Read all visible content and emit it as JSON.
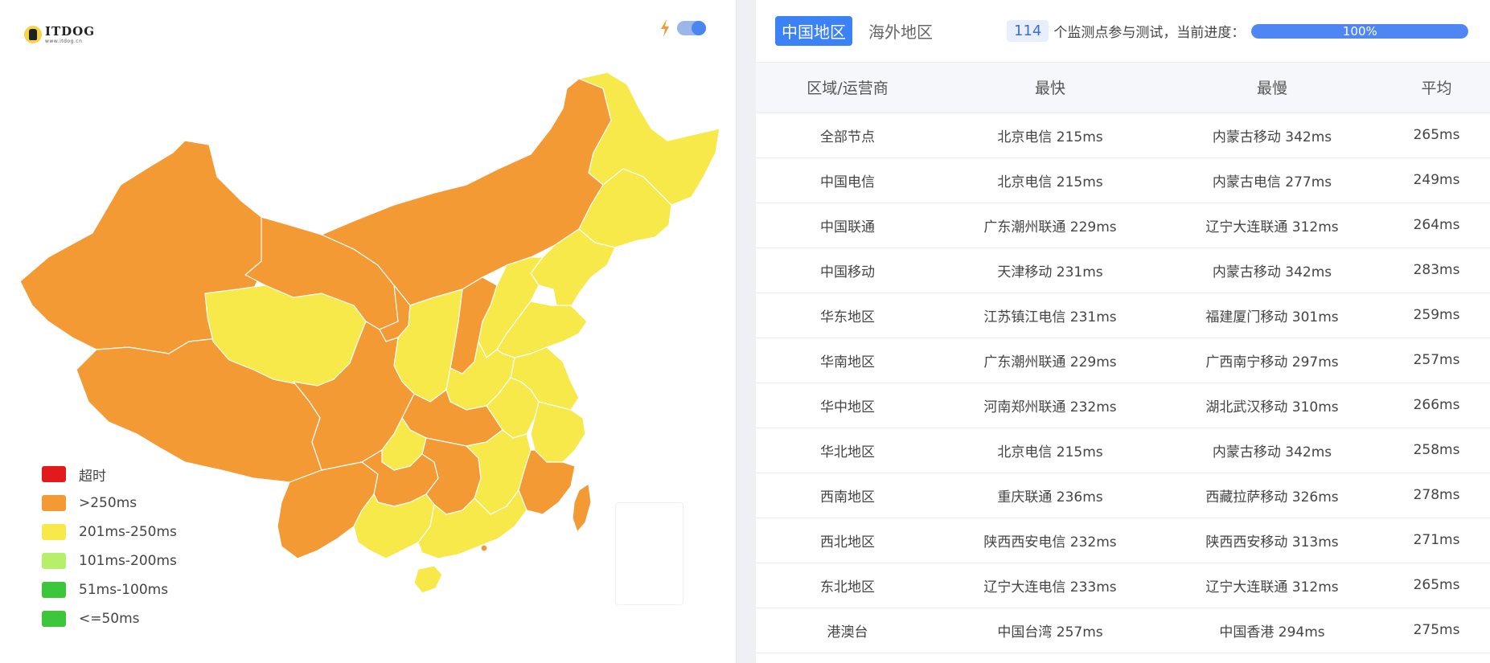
{
  "logo": {
    "title": "ITDOG",
    "subtitle": "www.itdog.cn"
  },
  "colors": {
    "timeout": "#e3191c",
    "over250": "#f49a35",
    "201_250": "#f7e94a",
    "101_200": "#b8ef6a",
    "51_100": "#3cc63c",
    "under50": "#3cc63c",
    "accent": "#3b82f6"
  },
  "legend": [
    {
      "label": "超时",
      "color": "#e3191c"
    },
    {
      "label": ">250ms",
      "color": "#f49a35"
    },
    {
      "label": "201ms-250ms",
      "color": "#f7e94a"
    },
    {
      "label": "101ms-200ms",
      "color": "#b8ef6a"
    },
    {
      "label": "51ms-100ms",
      "color": "#3cc63c"
    },
    {
      "label": "<=50ms",
      "color": "#3cc63c"
    }
  ],
  "tabs": {
    "active": "中国地区",
    "inactive": "海外地区"
  },
  "progress": {
    "count": "114",
    "text": "个监测点参与测试，当前进度：",
    "percent": 100,
    "label": "100%"
  },
  "table": {
    "headers": [
      "区域/运营商",
      "最快",
      "最慢",
      "平均"
    ],
    "rows": [
      [
        "全部节点",
        "北京电信 215ms",
        "内蒙古移动 342ms",
        "265ms"
      ],
      [
        "中国电信",
        "北京电信 215ms",
        "内蒙古电信 277ms",
        "249ms"
      ],
      [
        "中国联通",
        "广东潮州联通 229ms",
        "辽宁大连联通 312ms",
        "264ms"
      ],
      [
        "中国移动",
        "天津移动 231ms",
        "内蒙古移动 342ms",
        "283ms"
      ],
      [
        "华东地区",
        "江苏镇江电信 231ms",
        "福建厦门移动 301ms",
        "259ms"
      ],
      [
        "华南地区",
        "广东潮州联通 229ms",
        "广西南宁移动 297ms",
        "257ms"
      ],
      [
        "华中地区",
        "河南郑州联通 232ms",
        "湖北武汉移动 310ms",
        "266ms"
      ],
      [
        "华北地区",
        "北京电信 215ms",
        "内蒙古移动 342ms",
        "258ms"
      ],
      [
        "西南地区",
        "重庆联通 236ms",
        "西藏拉萨移动 326ms",
        "278ms"
      ],
      [
        "西北地区",
        "陕西西安电信 232ms",
        "陕西西安移动 313ms",
        "271ms"
      ],
      [
        "东北地区",
        "辽宁大连电信 233ms",
        "辽宁大连联通 312ms",
        "265ms"
      ],
      [
        "港澳台",
        "中国台湾 257ms",
        "中国香港 294ms",
        "275ms"
      ]
    ]
  }
}
